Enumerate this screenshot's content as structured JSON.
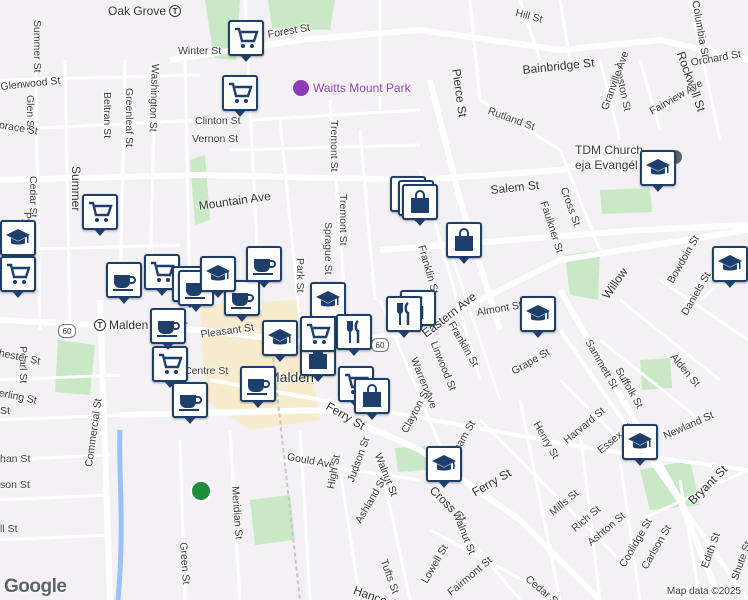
{
  "map": {
    "attribution": "Map data ©2025",
    "logo": "Google",
    "route_shield_60": "60",
    "route_shield_60b": "60"
  },
  "transit": {
    "oak_grove": "Oak Grove",
    "malden_center": "Malden Center",
    "transit_glyph": "T"
  },
  "poi": {
    "waitts_park": "Waitts Mount Park",
    "church_line1": "TDM Church",
    "church_line2": "eja Evangél"
  },
  "streets": {
    "winter": "Winter St",
    "forest": "Forest St",
    "glenwood": "Glenwood St",
    "summer_top": "Summer St",
    "glen": "Glen St",
    "beltran": "Beltran St",
    "greenleaf": "Greenleaf St",
    "washington": "Washington St",
    "clinton": "Clinton St",
    "vernon": "Vernon St",
    "tremont1": "Tremont St",
    "tremont2": "Tremont St",
    "sprague": "Sprague St",
    "park": "Park St",
    "mountain": "Mountain Ave",
    "salem": "Salem St",
    "pierce": "Pierce St",
    "bainbridge": "Bainbridge St",
    "hill": "Hill St",
    "columbia": "Columbia St",
    "rockwell": "Rockwell St",
    "orchard": "Orchard St",
    "preston": "Preston St",
    "granville": "Granville Ave",
    "fairview": "Fairview Ave",
    "rutland": "Rutland St",
    "faulkner": "Faulkner St",
    "cross_top": "Cross St",
    "franklin1": "Franklin St",
    "franklin2": "Franklin St",
    "eastern": "Eastern Ave",
    "almont": "Almont St",
    "linwood": "Linwood St",
    "warren": "Warren Ave",
    "willow": "Willow",
    "bowdoin": "Bowdoin St",
    "daniels": "Daniels St",
    "grape": "Grape St",
    "sammett": "Sammett St",
    "alden": "Alden St",
    "suffolk": "Suffolk St",
    "pleasant": "Pleasant St",
    "centre": "Centre St",
    "malden_city": "Malden",
    "ferry": "Ferry St",
    "ferry2": "Ferry St",
    "clayton": "Clayton St",
    "cross_mid": "Cross St",
    "gould": "Gould Ave",
    "walnut": "Walnut St",
    "walnut2": "Walnut St",
    "judson": "Judson St",
    "high": "High St",
    "ashland": "Ashland St",
    "meridian": "Meridian St",
    "green": "Green St",
    "henry": "Henry St",
    "harvard": "Harvard St",
    "essex": "Essex St",
    "newland": "Newland St",
    "mills": "Mills St",
    "rich": "Rich St",
    "ashton": "Ashton St",
    "coolidge": "Coolidge St",
    "carlson": "Carlson St",
    "bryant": "Bryant St",
    "edith": "Edith St",
    "shute": "Shute St",
    "tufts": "Tufts St",
    "lowell": "Lowell St",
    "fairmont": "Fairmont St",
    "cedar_bot": "Cedar St",
    "hancock": "Hancock",
    "commercial": "Commercial St",
    "pearl": "Pearl St",
    "cedar_left": "Cedar St",
    "summer_left": "Summer",
    "sterling": "erling St",
    "chester": "hester St",
    "horace": "orace St",
    "pyal": "Pyal",
    "ss": "Ss St",
    "son": "son St",
    "ian": "han St",
    "lst": "ll St",
    "mid_left": "St",
    "ham": "ham St"
  },
  "markers": [
    {
      "kind": "grocery"
    },
    {
      "kind": "grocery"
    },
    {
      "kind": "grocery"
    },
    {
      "kind": "shopping"
    },
    {
      "kind": "shopping"
    },
    {
      "kind": "shopping"
    },
    {
      "kind": "school"
    },
    {
      "kind": "cafe"
    },
    {
      "kind": "grocery"
    },
    {
      "kind": "cafe"
    },
    {
      "kind": "cafe"
    },
    {
      "kind": "cafe"
    },
    {
      "kind": "school"
    },
    {
      "kind": "restaurant"
    },
    {
      "kind": "restaurant"
    },
    {
      "kind": "school"
    },
    {
      "kind": "school"
    },
    {
      "kind": "school"
    },
    {
      "kind": "grocery"
    },
    {
      "kind": "cafe"
    },
    {
      "kind": "grocery"
    },
    {
      "kind": "shopping"
    },
    {
      "kind": "cafe"
    },
    {
      "kind": "school"
    },
    {
      "kind": "school"
    },
    {
      "kind": "cafe"
    },
    {
      "kind": "school"
    },
    {
      "kind": "restaurant"
    },
    {
      "kind": "cafe"
    },
    {
      "kind": "shopping"
    },
    {
      "kind": "grocery"
    },
    {
      "kind": "shopping"
    },
    {
      "kind": "school"
    },
    {
      "kind": "grocery"
    }
  ],
  "colors": {
    "road_major": "#ffffff",
    "road_minor": "#ffffff",
    "park": "#c9e9c6",
    "water": "#9cc0f9",
    "downtown": "#f7eccd",
    "marker_border": "#1e3f6b"
  }
}
